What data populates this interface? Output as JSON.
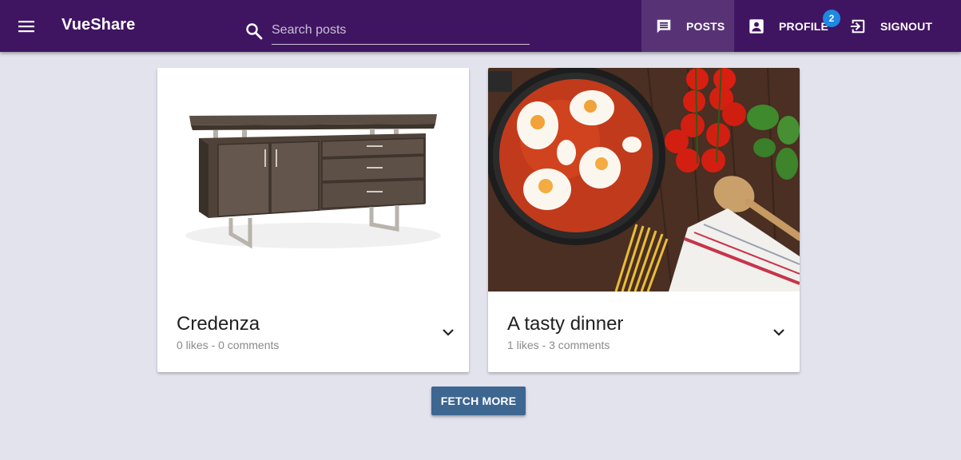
{
  "app": {
    "title": "VueShare"
  },
  "search": {
    "placeholder": "Search posts",
    "value": ""
  },
  "nav": {
    "posts_label": "POSTS",
    "profile_label": "PROFILE",
    "profile_badge": "2",
    "signout_label": "SIGNOUT",
    "active": "posts"
  },
  "posts": [
    {
      "title": "Credenza",
      "meta": "0 likes - 0 comments",
      "image": "credenza furniture photo"
    },
    {
      "title": "A tasty dinner",
      "meta": "1 likes - 3 comments",
      "image": "shakshuka pan with tomatoes, pasta and spoon photo"
    }
  ],
  "actions": {
    "fetch_more_label": "FETCH MORE"
  },
  "colors": {
    "toolbar": "#3f1562",
    "background": "#e3e3ee",
    "badge": "#1e88e5",
    "button": "#3d6691"
  }
}
